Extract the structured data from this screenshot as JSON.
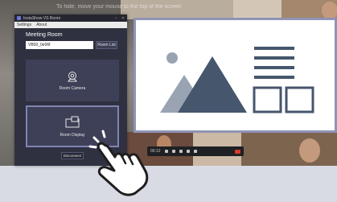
{
  "background": {
    "notification_text": "To hide, move your mouse to the top of the screen",
    "toolbar": {
      "time": "00:12"
    }
  },
  "app": {
    "window_title": "InstaShow VS Room",
    "menu": [
      "Settings",
      "About"
    ],
    "room_title": "Meeting Room",
    "room_input_value": "VB00_0e06f",
    "room_list_button": "Room List",
    "cards": {
      "camera_label": "Room Camera",
      "display_label": "Room Display"
    },
    "disconnect_button": "Disconnect"
  },
  "colors": {
    "app_bg": "#2f3140",
    "card_bg": "#3e4057",
    "selected_border": "#7f84b4",
    "illustration_dark": "#45566d",
    "illustration_light": "#9aa3b2"
  },
  "icons": [
    "camera-icon",
    "display-icon",
    "image-placeholder-icon",
    "pointing-hand-icon"
  ]
}
